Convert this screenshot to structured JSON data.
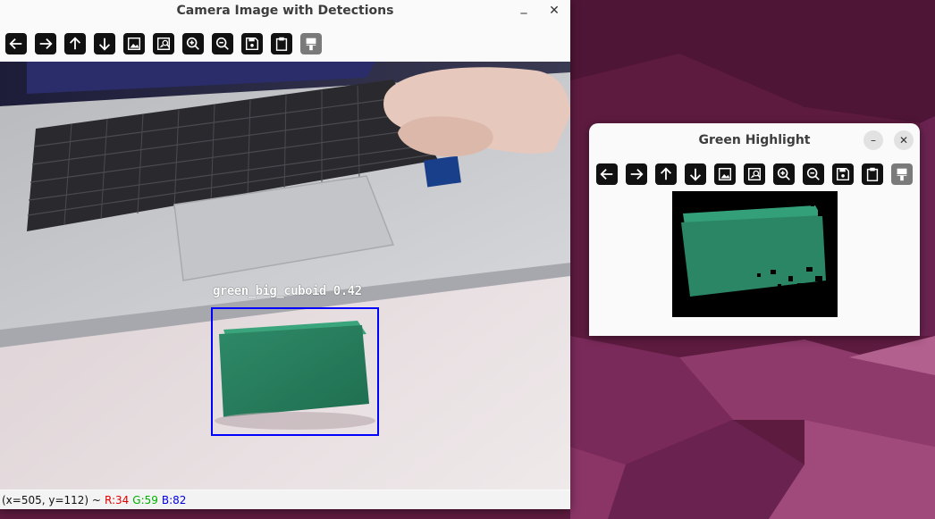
{
  "main_window": {
    "title": "Camera Image with Detections",
    "minimize_glyph": "_",
    "close_glyph": "✕",
    "toolbar": [
      "arrow-left-icon",
      "arrow-right-icon",
      "arrow-up-icon",
      "arrow-down-icon",
      "image-icon",
      "image-search-icon",
      "zoom-in-icon",
      "zoom-out-icon",
      "save-icon",
      "clipboard-icon",
      "paint-brush-icon"
    ],
    "detection": {
      "label": "green_big_cuboid 0.42",
      "box_color": "#0000ff"
    },
    "status": {
      "coords": "(x=505, y=112) ~",
      "r": "R:34",
      "g": "G:59",
      "b": "B:82"
    }
  },
  "highlight_window": {
    "title": "Green Highlight",
    "minimize_glyph": "–",
    "close_glyph": "✕",
    "toolbar": [
      "arrow-left-icon",
      "arrow-right-icon",
      "arrow-up-icon",
      "arrow-down-icon",
      "image-icon",
      "image-search-icon",
      "zoom-in-icon",
      "zoom-out-icon",
      "save-icon",
      "clipboard-icon",
      "paint-brush-icon"
    ]
  },
  "colors": {
    "cuboid_green": "#2e8a68",
    "wallpaper": "#6b1f4a",
    "status_r": "#e00000",
    "status_g": "#00b000",
    "status_b": "#0000e0"
  }
}
